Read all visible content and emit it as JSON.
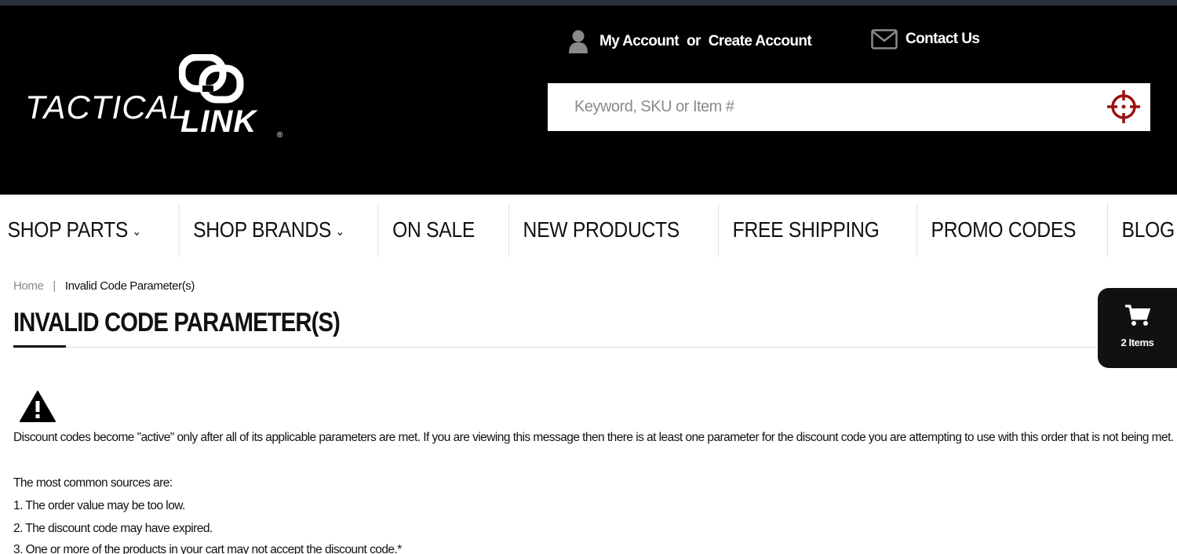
{
  "header": {
    "logo": {
      "word1": "TACTICAL",
      "word2": "LINK",
      "reg": "®"
    },
    "account": {
      "my_account": "My Account",
      "or": "or",
      "create_account": "Create Account"
    },
    "contact": {
      "label": "Contact Us"
    },
    "search": {
      "placeholder": "Keyword, SKU or Item #"
    }
  },
  "nav": {
    "items": [
      {
        "label": "SHOP PARTS",
        "dropdown": true
      },
      {
        "label": "SHOP BRANDS",
        "dropdown": true
      },
      {
        "label": "ON SALE"
      },
      {
        "label": "NEW PRODUCTS"
      },
      {
        "label": "FREE SHIPPING"
      },
      {
        "label": "PROMO CODES"
      },
      {
        "label": "BLOG"
      }
    ],
    "chevron": "⌄"
  },
  "breadcrumb": {
    "home": "Home",
    "separator": "|",
    "current": "Invalid Code Parameter(s)"
  },
  "page": {
    "title": "INVALID CODE PARAMETER(S)",
    "intro": "Discount codes become \"active\" only after all of its applicable parameters are met. If you are viewing this message then there is at least one parameter for the discount code you are attempting to use with this order that is not being met.",
    "sources_heading": "The most common sources are:",
    "sources": [
      "1. The order value may be too low.",
      "2. The discount code may have expired.",
      "3. One or more of the products in your cart may not accept the discount code.*"
    ]
  },
  "cart": {
    "count_label": "2 Items"
  },
  "colors": {
    "header_bg": "#000000",
    "accent_red": "#9b1111",
    "topline": "#2b3140"
  },
  "icons": {
    "user": "user-icon",
    "mail": "mail-icon",
    "search": "crosshair-icon",
    "cart": "cart-icon",
    "warning": "warning-icon"
  }
}
